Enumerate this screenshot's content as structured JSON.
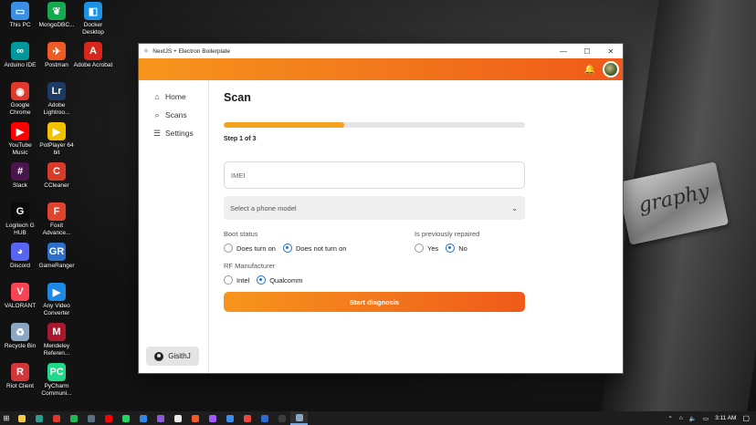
{
  "desktop": {
    "icons": [
      {
        "label": "This PC",
        "color": "#3a8ee6",
        "glyph": "▭"
      },
      {
        "label": "MongoDBC...",
        "color": "#13aa52",
        "glyph": "❦"
      },
      {
        "label": "Docker Desktop",
        "color": "#1d91e6",
        "glyph": "◧"
      },
      {
        "label": "Arduino IDE",
        "color": "#00979c",
        "glyph": "∞"
      },
      {
        "label": "Postman",
        "color": "#ef5b25",
        "glyph": "✈"
      },
      {
        "label": "Adobe Acrobat",
        "color": "#d9261c",
        "glyph": "A"
      },
      {
        "label": "Google Chrome",
        "color": "#e0382d",
        "glyph": "◉"
      },
      {
        "label": "Adobe Lightroo...",
        "color": "#1c3a63",
        "glyph": "Lr"
      },
      {
        "label": "YouTube Music",
        "color": "#ff0000",
        "glyph": "▶"
      },
      {
        "label": "PotPlayer 64 bit",
        "color": "#f2c200",
        "glyph": "▶"
      },
      {
        "label": "Slack",
        "color": "#4a154b",
        "glyph": "#"
      },
      {
        "label": "CCleaner",
        "color": "#d83b2a",
        "glyph": "C"
      },
      {
        "label": "Logitech G HUB",
        "color": "#0a0a0a",
        "glyph": "G"
      },
      {
        "label": "Foxit Advance...",
        "color": "#e0442f",
        "glyph": "F"
      },
      {
        "label": "Discord",
        "color": "#5865f2",
        "glyph": "◕"
      },
      {
        "label": "GameRanger",
        "color": "#2b6fc9",
        "glyph": "GR"
      },
      {
        "label": "VALORANT",
        "color": "#fa4454",
        "glyph": "V"
      },
      {
        "label": "Any Video Converter",
        "color": "#1e88e5",
        "glyph": "▶"
      },
      {
        "label": "Recycle Bin",
        "color": "#8aa6c1",
        "glyph": "♻"
      },
      {
        "label": "Mendeley Referen...",
        "color": "#a6192e",
        "glyph": "M"
      },
      {
        "label": "Riot Client",
        "color": "#d13639",
        "glyph": "R"
      },
      {
        "label": "PyCharm Communi...",
        "color": "#21d789",
        "glyph": "PC"
      }
    ]
  },
  "wallpaper_text": "graphy",
  "window": {
    "title": "NextJS + Electron Boilerplate",
    "minimize": "—",
    "maximize": "☐",
    "close": "✕"
  },
  "appbar": {
    "bell_icon": "🔔"
  },
  "sidebar": {
    "items": [
      {
        "label": "Home",
        "icon": "⌂"
      },
      {
        "label": "Scans",
        "icon": "⌕"
      },
      {
        "label": "Settings",
        "icon": "☰"
      }
    ],
    "user_name": "GisithJ"
  },
  "main": {
    "title": "Scan",
    "progress": 0.4,
    "step_label": "Step 1 of 3",
    "imei_placeholder": "IMEI",
    "imei_value": "",
    "phone_model_placeholder": "Select a phone model",
    "boot_status": {
      "label": "Boot status",
      "options": [
        "Does turn on",
        "Does not turn on"
      ],
      "selected": "Does not turn on"
    },
    "previously_repaired": {
      "label": "Is previously repaired",
      "options": [
        "Yes",
        "No"
      ],
      "selected": "No"
    },
    "rf_manufacturer": {
      "label": "RF Manufacturer",
      "options": [
        "Intel",
        "Qualcomm"
      ],
      "selected": "Qualcomm"
    },
    "start_button": "Start diagnosis"
  },
  "colors": {
    "accent_start": "#f7951d",
    "accent_end": "#ef5a1a",
    "progress": "#f4a31f",
    "radio_checked": "#1a6fd8"
  },
  "taskbar": {
    "start_icon": "⊞",
    "apps": [
      {
        "name": "file-explorer",
        "color": "#f2c94c"
      },
      {
        "name": "edge",
        "color": "#2a9d8f"
      },
      {
        "name": "chrome",
        "color": "#e0382d"
      },
      {
        "name": "spotify",
        "color": "#1db954"
      },
      {
        "name": "steam",
        "color": "#5a6f86"
      },
      {
        "name": "youtube-music",
        "color": "#ff0000"
      },
      {
        "name": "whatsapp",
        "color": "#25d366"
      },
      {
        "name": "vscode",
        "color": "#2b8ae6"
      },
      {
        "name": "visual-studio",
        "color": "#8a5cd0"
      },
      {
        "name": "notion",
        "color": "#e8e8e8"
      },
      {
        "name": "postman",
        "color": "#ef5b25"
      },
      {
        "name": "figma",
        "color": "#a259ff"
      },
      {
        "name": "todo",
        "color": "#3f8cf0"
      },
      {
        "name": "anydesk",
        "color": "#ef443b"
      },
      {
        "name": "word",
        "color": "#2b6cd4"
      },
      {
        "name": "terminal",
        "color": "#3c3c3c"
      },
      {
        "name": "electron-app",
        "color": "#8fa6bf"
      }
    ],
    "active_app": "electron-app",
    "tray": {
      "chevron": "⌃",
      "network": "⌂",
      "volume": "🔈",
      "battery": "▭",
      "time": "3:11 AM",
      "notification_icon": "▢"
    }
  }
}
